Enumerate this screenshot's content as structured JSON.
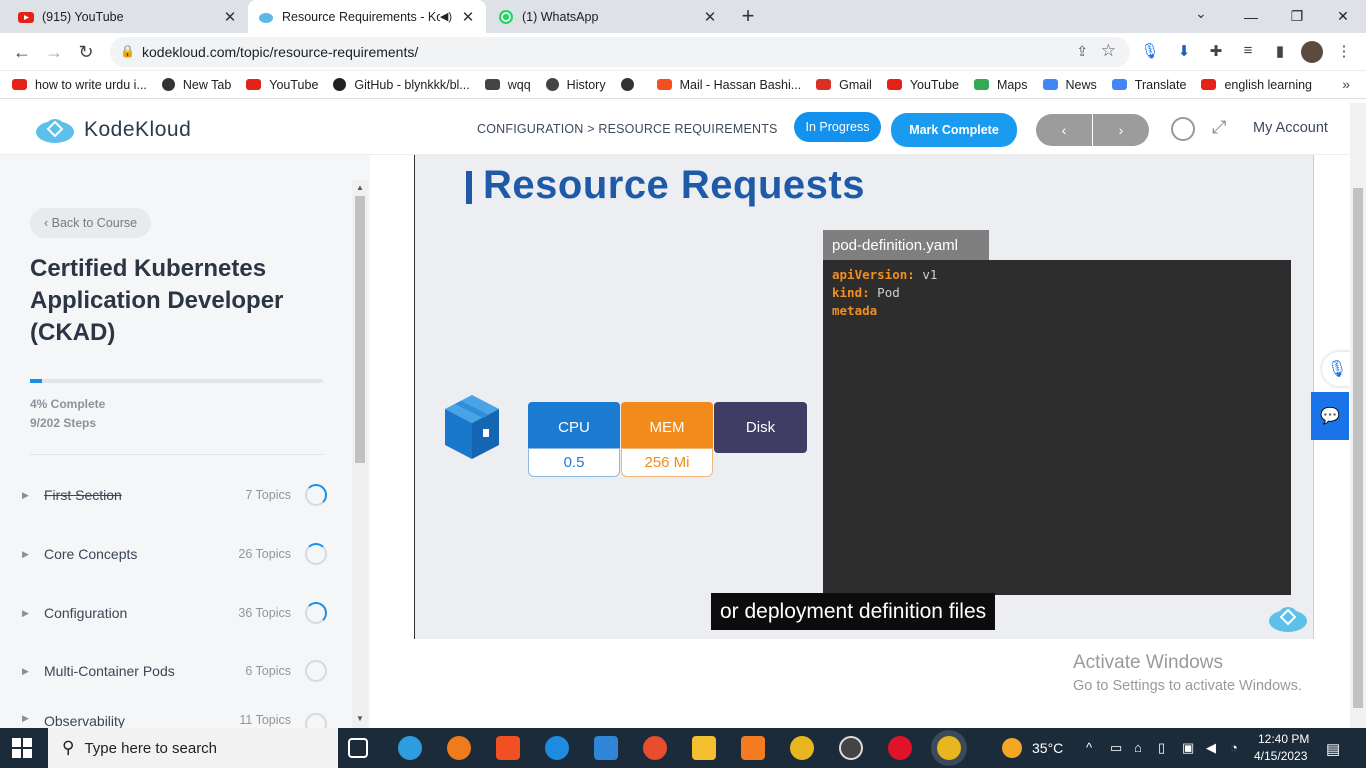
{
  "browser": {
    "tabs": [
      {
        "title": "(915) YouTube",
        "icon": "youtube-icon"
      },
      {
        "title": "Resource Requirements - Ko",
        "icon": "kodekloud-icon"
      },
      {
        "title": "(1) WhatsApp",
        "icon": "whatsapp-icon"
      }
    ],
    "url": "kodekloud.com/topic/resource-requirements/",
    "bookmarks": [
      {
        "label": "how to write urdu i...",
        "icon": "youtube-icon"
      },
      {
        "label": "New Tab",
        "icon": "globe-icon"
      },
      {
        "label": "YouTube",
        "icon": "youtube-icon"
      },
      {
        "label": "GitHub - blynkkk/bl...",
        "icon": "github-icon"
      },
      {
        "label": "wqq",
        "icon": "download-icon"
      },
      {
        "label": "History",
        "icon": "history-icon"
      },
      {
        "label": "",
        "icon": "globe-icon"
      },
      {
        "label": "Mail - Hassan Bashi...",
        "icon": "microsoft-icon"
      },
      {
        "label": "Gmail",
        "icon": "gmail-icon"
      },
      {
        "label": "YouTube",
        "icon": "youtube-icon"
      },
      {
        "label": "Maps",
        "icon": "maps-icon"
      },
      {
        "label": "News",
        "icon": "news-icon"
      },
      {
        "label": "Translate",
        "icon": "translate-icon"
      },
      {
        "label": "english learning",
        "icon": "youtube-icon"
      }
    ]
  },
  "header": {
    "logo_text": "KodeKloud",
    "breadcrumb": "CONFIGURATION > RESOURCE REQUIREMENTS",
    "status_label": "In Progress",
    "mark_complete_label": "Mark Complete",
    "prev_label": "‹",
    "next_label": "›",
    "account_label": "My Account"
  },
  "sidebar": {
    "back_label": "‹  Back to Course",
    "course_title": "Certified Kubernetes Application Developer (CKAD)",
    "progress_fraction": 0.04,
    "complete_text": "4% Complete",
    "steps_text": "9/202 Steps",
    "sections": [
      {
        "name": "First Section",
        "count": "7 Topics",
        "done": true
      },
      {
        "name": "Core Concepts",
        "count": "26 Topics",
        "done": false
      },
      {
        "name": "Configuration",
        "count": "36 Topics",
        "done": false
      },
      {
        "name": "Multi-Container Pods",
        "count": "6 Topics",
        "done": false
      },
      {
        "name": "Observability",
        "count": "11 Topics",
        "done": false
      }
    ]
  },
  "video": {
    "slide_title": "Resource Requests",
    "yaml_filename": "pod-definition.yaml",
    "yaml_lines": [
      {
        "key": "apiVersion:",
        "value": " v1"
      },
      {
        "key": "kind:",
        "value": " Pod"
      },
      {
        "key": "metada",
        "value": ""
      }
    ],
    "resources": [
      {
        "label": "CPU",
        "value": "0.5",
        "color": "#1b7bd1"
      },
      {
        "label": "MEM",
        "value": "256 Mi",
        "color": "#f28a1c"
      },
      {
        "label": "Disk",
        "value": "",
        "color": "#3f3d64"
      }
    ],
    "subtitle": "or deployment definition files"
  },
  "watermark": {
    "line1": "Activate Windows",
    "line2": "Go to Settings to activate Windows."
  },
  "taskbar": {
    "search_placeholder": "Type here to search",
    "temperature": "35°C",
    "time": "12:40 PM",
    "date": "4/15/2023"
  }
}
